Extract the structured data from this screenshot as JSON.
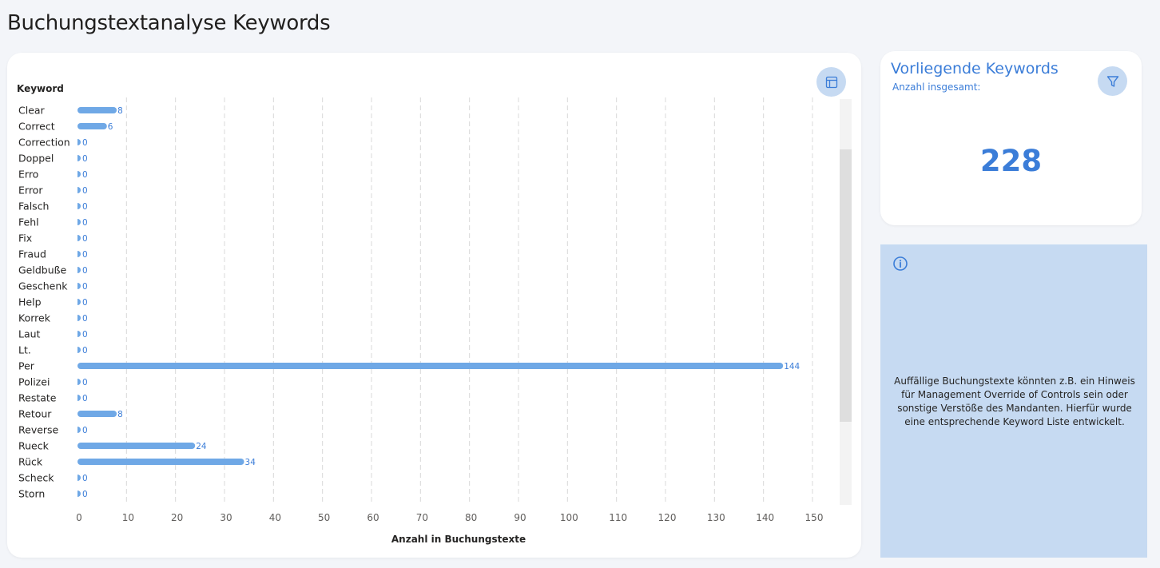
{
  "page": {
    "title": "Buchungstextanalyse Keywords"
  },
  "chart_data": {
    "type": "bar",
    "orientation": "horizontal",
    "title": "",
    "ylabel": "Keyword",
    "xlabel": "Anzahl in Buchungstexte",
    "categories": [
      "Clear",
      "Correct",
      "Correction",
      "Doppel",
      "Erro",
      "Error",
      "Falsch",
      "Fehl",
      "Fix",
      "Fraud",
      "Geldbuße",
      "Geschenk",
      "Help",
      "Korrek",
      "Laut",
      "Lt.",
      "Per",
      "Polizei",
      "Restate",
      "Retour",
      "Reverse",
      "Rueck",
      "Rück",
      "Scheck",
      "Storn"
    ],
    "values": [
      8,
      6,
      0,
      0,
      0,
      0,
      0,
      0,
      0,
      0,
      0,
      0,
      0,
      0,
      0,
      0,
      144,
      0,
      0,
      8,
      0,
      24,
      34,
      0,
      0
    ],
    "xlim": [
      0,
      150
    ],
    "xticks": [
      0,
      10,
      20,
      30,
      40,
      50,
      60,
      70,
      80,
      90,
      100,
      110,
      120,
      130,
      140,
      150
    ],
    "grid": "vertical-dashed",
    "bar_color": "#6fa8e6",
    "label_color": "#3b7dd8"
  },
  "toolbar": {
    "table_icon": "table-icon"
  },
  "kpi": {
    "title": "Vorliegende Keywords",
    "subtitle": "Anzahl insgesamt:",
    "value": "228",
    "filter_icon": "filter-icon"
  },
  "info": {
    "icon": "info-icon",
    "text": "Auffällige Buchungstexte könnten z.B. ein Hinweis für Management Override of Controls sein oder sonstige Verstöße des Mandanten. Hierfür wurde eine entsprechende Keyword Liste entwickelt."
  },
  "colors": {
    "accent": "#3b7dd8",
    "panel_blue": "#c6daf2",
    "background": "#f3f5f9"
  }
}
